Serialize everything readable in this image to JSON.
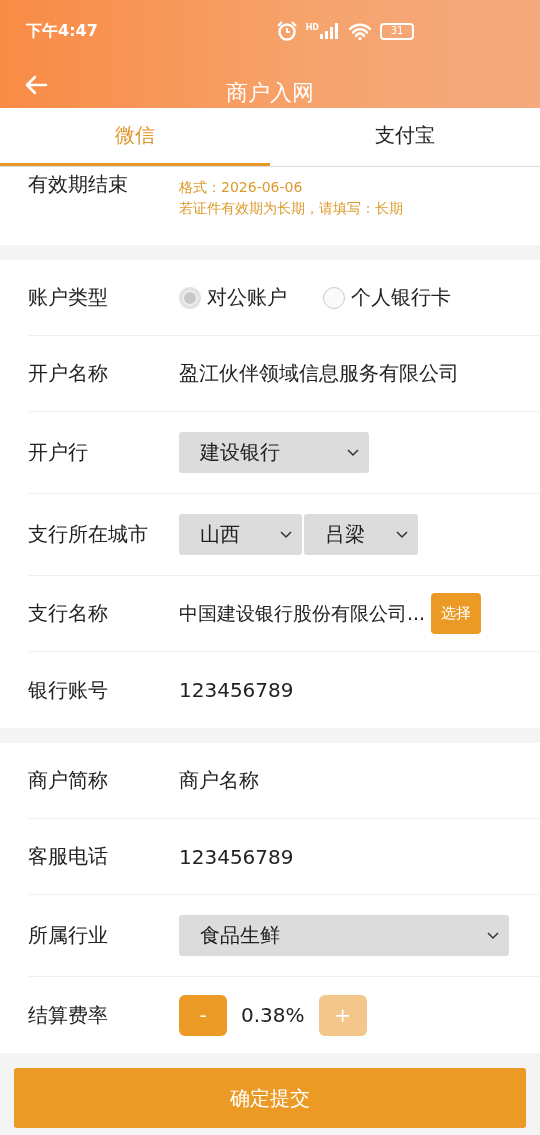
{
  "status_bar": {
    "time": "下午4:47",
    "network": "HD",
    "battery": "31"
  },
  "header": {
    "title": "商户入网"
  },
  "tabs": [
    {
      "label": "微信",
      "selected": true
    },
    {
      "label": "支付宝",
      "selected": false
    }
  ],
  "sections": [
    {
      "rows": [
        {
          "kind": "hint",
          "label": "有效期结束",
          "hints": [
            "格式：2026-06-06",
            "若证件有效期为长期，请填写：长期"
          ]
        }
      ]
    },
    {
      "rows": [
        {
          "kind": "radio",
          "label": "账户类型",
          "options": [
            {
              "label": "对公账户",
              "selected": true
            },
            {
              "label": "个人银行卡",
              "selected": false
            }
          ]
        },
        {
          "kind": "text",
          "label": "开户名称",
          "value": "盈江伙伴领域信息服务有限公司"
        },
        {
          "kind": "select",
          "label": "开户行",
          "selects": [
            {
              "value": "建设银行"
            }
          ]
        },
        {
          "kind": "select",
          "label": "支行所在城市",
          "selects": [
            {
              "value": "山西"
            },
            {
              "value": "吕梁"
            }
          ]
        },
        {
          "kind": "pick",
          "label": "支行名称",
          "value": "中国建设银行股份有限公司...",
          "button": "选择"
        },
        {
          "kind": "text",
          "label": "银行账号",
          "value": "123456789"
        }
      ]
    },
    {
      "rows": [
        {
          "kind": "text",
          "label": "商户简称",
          "value": "商户名称"
        },
        {
          "kind": "text",
          "label": "客服电话",
          "value": "123456789"
        },
        {
          "kind": "select",
          "label": "所属行业",
          "selects": [
            {
              "value": "食品生鲜"
            }
          ]
        },
        {
          "kind": "stepper",
          "label": "结算费率",
          "minus": {
            "label": "-",
            "disabled": false
          },
          "value": "0.38%",
          "plus": {
            "label": "+",
            "disabled": true
          }
        }
      ]
    }
  ],
  "submit": {
    "label": "确定提交"
  }
}
